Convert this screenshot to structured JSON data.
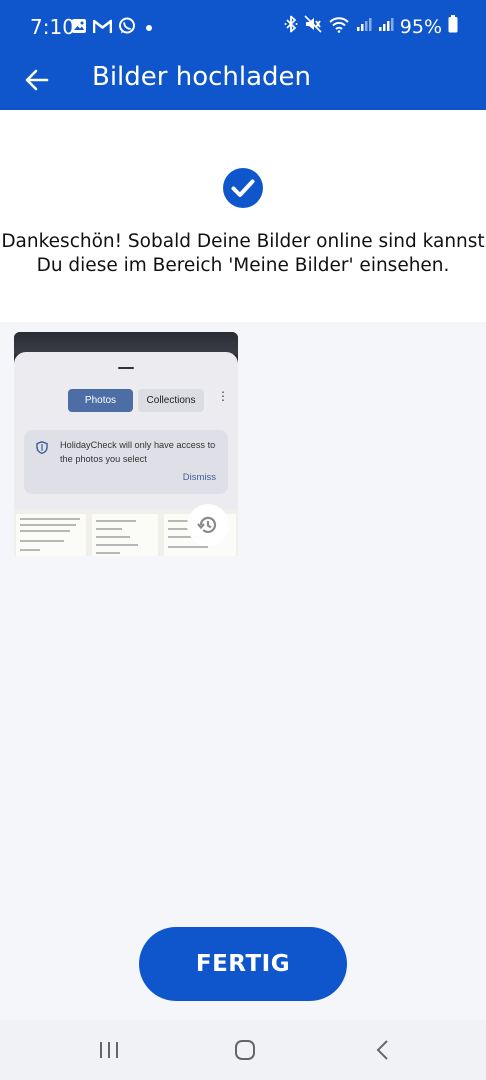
{
  "status_bar": {
    "time": "7:10",
    "battery_percent": "95%",
    "left_icons": [
      "image-icon",
      "gmail-icon",
      "whatsapp-icon",
      "dot-icon"
    ],
    "right_icons": [
      "bluetooth-icon",
      "mute-icon",
      "wifi-icon",
      "signal-icon",
      "signal-icon",
      "battery-icon"
    ]
  },
  "app_bar": {
    "title": "Bilder hochladen"
  },
  "confirmation": {
    "message": "Dankeschön! Sobald Deine Bilder online sind kannst Du diese im Bereich 'Meine Bilder' einsehen."
  },
  "thumbnail": {
    "tab_photos": "Photos",
    "tab_collections": "Collections",
    "notice_text": "HolidayCheck will only have access to the photos you select",
    "notice_dismiss": "Dismiss"
  },
  "actions": {
    "done_label": "FERTIG"
  },
  "colors": {
    "brand_blue": "#0f56cc",
    "background": "#f5f6fa"
  }
}
